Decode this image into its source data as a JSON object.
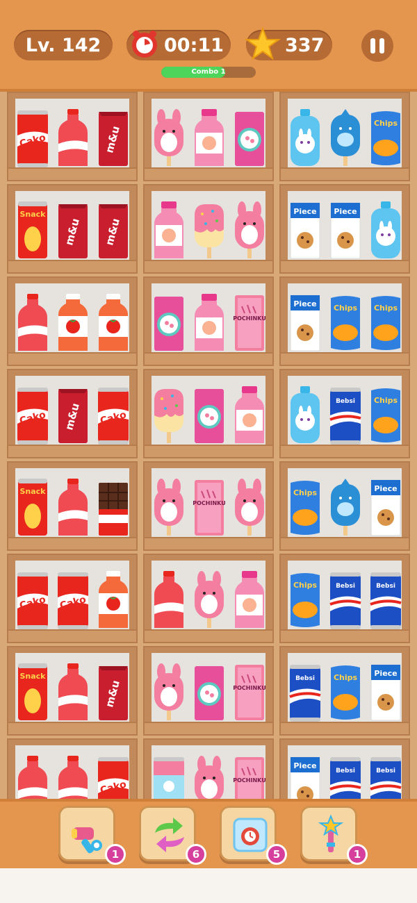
{
  "hud": {
    "level": "Lv. 142",
    "timer": "00:11",
    "score": "337",
    "combo_label": "Combo 1",
    "combo_progress": 0.68
  },
  "shelves": [
    [
      "cako-can",
      "soda-bottle",
      "mnu-bar",
      "pink-bunny-popsicle",
      "peach-juice",
      "pink-candy-box",
      "bunny-bottle",
      "blue-dolphin",
      "chips-bag"
    ],
    [
      "snack-tube",
      "mnu-bar",
      "mnu-bar",
      "peach-juice",
      "sprinkle-popsicle",
      "pink-bunny-popsicle",
      "piece-cookie-box",
      "piece-cookie-box",
      "bunny-bottle"
    ],
    [
      "soda-bottle",
      "tomato-juice",
      "tomato-juice",
      "pink-candy-box",
      "peach-juice",
      "pochinku-box",
      "piece-cookie-box",
      "chips-bag",
      "chips-bag"
    ],
    [
      "cako-can",
      "mnu-bar",
      "cako-can",
      "sprinkle-popsicle",
      "pink-candy-box",
      "peach-juice",
      "bunny-bottle",
      "bebsi-can",
      "chips-bag"
    ],
    [
      "snack-tube",
      "soda-bottle",
      "chocolate-bar",
      "pink-bunny-popsicle",
      "pochinku-box",
      "pink-bunny-popsicle",
      "chips-bag",
      "blue-dolphin",
      "piece-cookie-box"
    ],
    [
      "cako-can",
      "cako-can",
      "tomato-juice",
      "soda-bottle",
      "pink-bunny-popsicle",
      "peach-juice",
      "chips-bag",
      "bebsi-can",
      "bebsi-can"
    ],
    [
      "snack-tube",
      "soda-bottle",
      "mnu-bar",
      "pink-bunny-popsicle",
      "pink-candy-box",
      "pochinku-box",
      "bebsi-can",
      "chips-bag",
      "piece-cookie-box"
    ],
    [
      "soda-bottle",
      "soda-bottle",
      "cako-can",
      "unicorn-can",
      "pink-bunny-popsicle",
      "pochinku-box",
      "piece-cookie-box",
      "bebsi-can",
      "bebsi-can"
    ]
  ],
  "labels": {
    "cako": "Cako",
    "snack": "Snack",
    "mnu": "m&u",
    "piece": "Piece",
    "chips": "Chips",
    "bebsi": "Bebsi",
    "pochinku": "POCHINKU"
  },
  "tools": [
    {
      "icon": "hammer-icon",
      "count": "1"
    },
    {
      "icon": "shuffle-icon",
      "count": "6"
    },
    {
      "icon": "freeze-icon",
      "count": "5"
    },
    {
      "icon": "magic-wand-icon",
      "count": "1"
    }
  ],
  "colors": {
    "topbar": "#e5964e",
    "pill": "#b66b34",
    "combo_fill": "#4cd55a",
    "badge": "#d63f9b"
  }
}
